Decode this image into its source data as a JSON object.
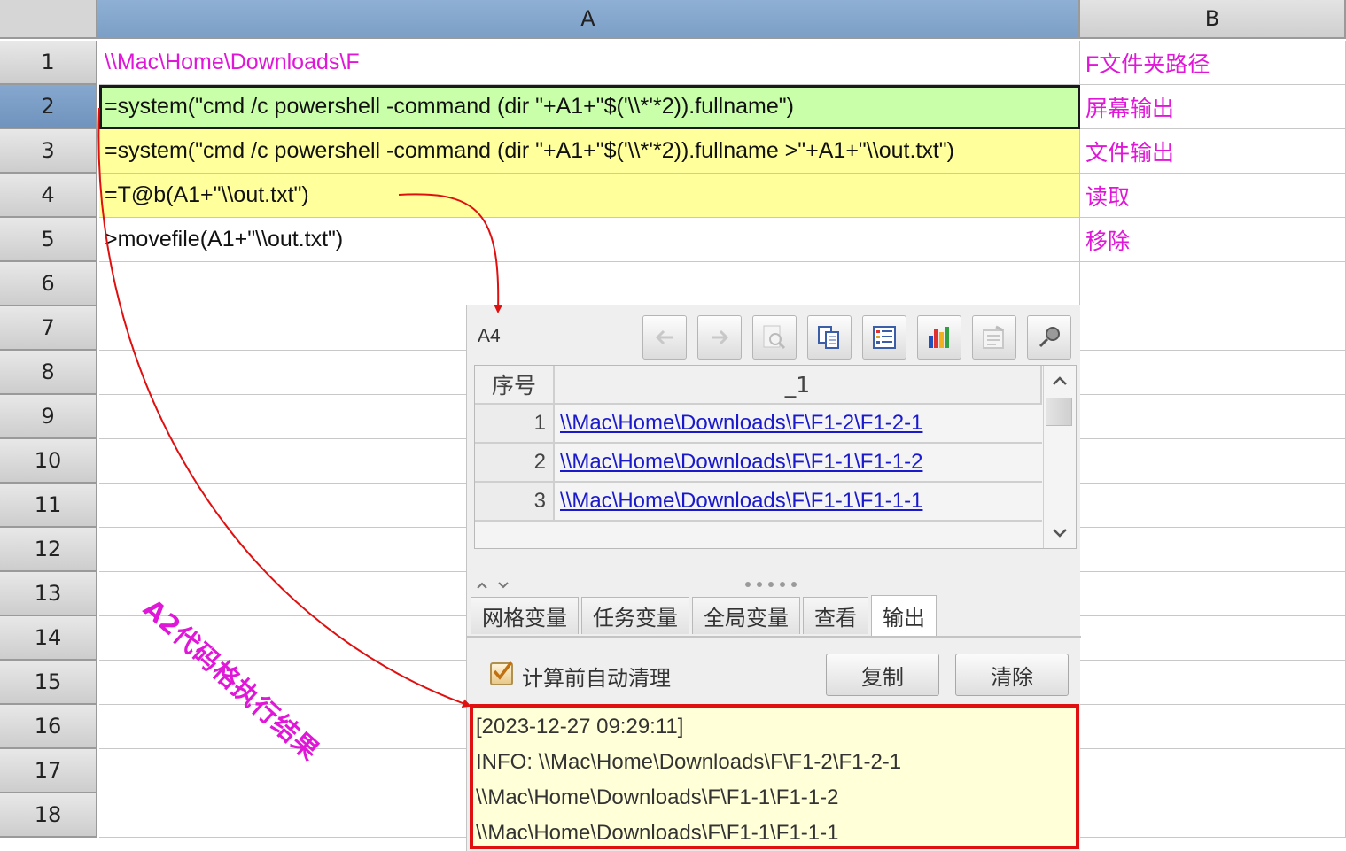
{
  "spreadsheet": {
    "columns": [
      "A",
      "B"
    ],
    "rows": [
      {
        "num": "1",
        "a": "\\\\Mac\\Home\\Downloads\\F",
        "b": "F文件夹路径"
      },
      {
        "num": "2",
        "a": "=system(\"cmd /c powershell -command (dir \"+A1+\"$('\\\\*'*2)).fullname\")",
        "b": "屏幕输出"
      },
      {
        "num": "3",
        "a": "=system(\"cmd /c powershell -command (dir \"+A1+\"$('\\\\*'*2)).fullname >\"+A1+\"\\\\out.txt\")",
        "b": "文件输出"
      },
      {
        "num": "4",
        "a": "=T@b(A1+\"\\\\out.txt\")",
        "b": "读取"
      },
      {
        "num": "5",
        "a": ">movefile(A1+\"\\\\out.txt\")",
        "b": "移除"
      },
      {
        "num": "6",
        "a": "",
        "b": ""
      },
      {
        "num": "7",
        "a": "",
        "b": ""
      },
      {
        "num": "8",
        "a": "",
        "b": ""
      },
      {
        "num": "9",
        "a": "",
        "b": ""
      },
      {
        "num": "10",
        "a": "",
        "b": ""
      },
      {
        "num": "11",
        "a": "",
        "b": ""
      },
      {
        "num": "12",
        "a": "",
        "b": ""
      },
      {
        "num": "13",
        "a": "",
        "b": ""
      },
      {
        "num": "14",
        "a": "",
        "b": ""
      },
      {
        "num": "15",
        "a": "",
        "b": ""
      },
      {
        "num": "16",
        "a": "",
        "b": ""
      },
      {
        "num": "17",
        "a": "",
        "b": ""
      },
      {
        "num": "18",
        "a": "",
        "b": ""
      }
    ],
    "selected_row": "2"
  },
  "panel": {
    "cell_ref": "A4",
    "toolbar_icons": [
      "arrow-left-icon",
      "arrow-right-icon",
      "zoom-icon",
      "copy-icon",
      "list-icon",
      "chart-icon",
      "properties-icon",
      "pin-icon"
    ],
    "table": {
      "headers": [
        "序号",
        "_1"
      ],
      "rows": [
        {
          "n": "1",
          "v": "\\\\Mac\\Home\\Downloads\\F\\F1-2\\F1-2-1"
        },
        {
          "n": "2",
          "v": "\\\\Mac\\Home\\Downloads\\F\\F1-1\\F1-1-2"
        },
        {
          "n": "3",
          "v": "\\\\Mac\\Home\\Downloads\\F\\F1-1\\F1-1-1"
        }
      ]
    },
    "tabs": [
      "网格变量",
      "任务变量",
      "全局变量",
      "查看",
      "输出"
    ],
    "active_tab": "输出",
    "auto_clear_label": "计算前自动清理",
    "auto_clear_checked": true,
    "copy_label": "复制",
    "clear_label": "清除",
    "console_lines": [
      "[2023-12-27 09:29:11]",
      "INFO: \\\\Mac\\Home\\Downloads\\F\\F1-2\\F1-2-1",
      "\\\\Mac\\Home\\Downloads\\F\\F1-1\\F1-1-2",
      "\\\\Mac\\Home\\Downloads\\F\\F1-1\\F1-1-1"
    ]
  },
  "annotation": "A2代码格执行结果",
  "colors": {
    "accent_pink": "#e016d8",
    "arrow_red": "#e01010",
    "row2_green": "#c9ffa8",
    "row34_yellow": "#ffff9c",
    "console_bg": "#ffffd8"
  }
}
